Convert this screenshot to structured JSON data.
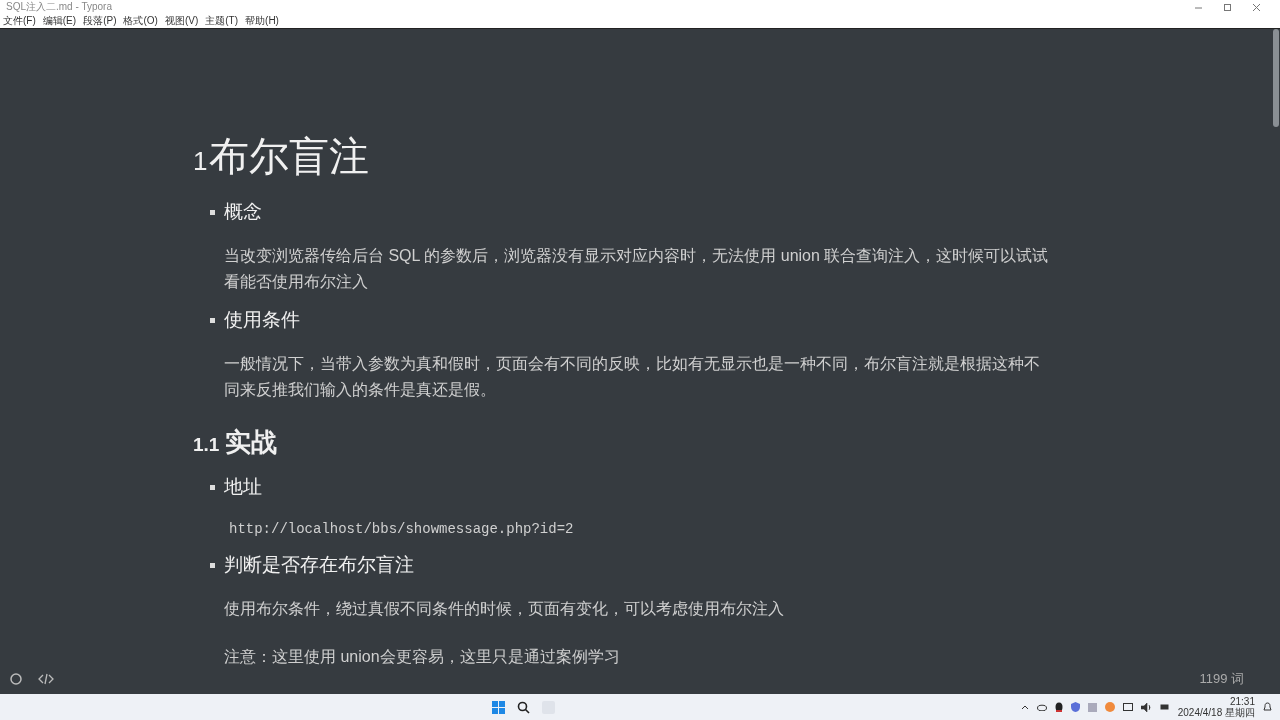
{
  "window": {
    "title": "SQL注入二.md - Typora"
  },
  "menu": [
    "文件(F)",
    "编辑(E)",
    "段落(P)",
    "格式(O)",
    "视图(V)",
    "主题(T)",
    "帮助(H)"
  ],
  "blocks": [
    {
      "kind": "h1",
      "number": "1",
      "text": "布尔盲注"
    },
    {
      "kind": "bullet",
      "text": "概念"
    },
    {
      "kind": "para",
      "text": "当改变浏览器传给后台 SQL 的参数后，浏览器没有显示对应内容时，无法使用 union 联合查询注入，这时候可以试试看能否使用布尔注入"
    },
    {
      "kind": "bullet",
      "text": "使用条件"
    },
    {
      "kind": "para",
      "text": "一般情况下，当带入参数为真和假时，页面会有不同的反映，比如有无显示也是一种不同，布尔盲注就是根据这种不同来反推我们输入的条件是真还是假。"
    },
    {
      "kind": "h2",
      "number": "1.1",
      "text": "实战"
    },
    {
      "kind": "bullet",
      "text": "地址"
    },
    {
      "kind": "code",
      "text": "http://localhost/bbs/showmessage.php?id=2"
    },
    {
      "kind": "bullet",
      "text": "判断是否存在布尔盲注"
    },
    {
      "kind": "para",
      "text": "使用布尔条件，绕过真假不同条件的时候，页面有变化，可以考虑使用布尔注入"
    },
    {
      "kind": "para",
      "text": "注意：这里使用 union会更容易，这里只是通过案例学习"
    }
  ],
  "status_bar": {
    "word_count": "1199 词"
  },
  "taskbar": {
    "time": "21:31",
    "date": "2024/4/18 星期四"
  }
}
